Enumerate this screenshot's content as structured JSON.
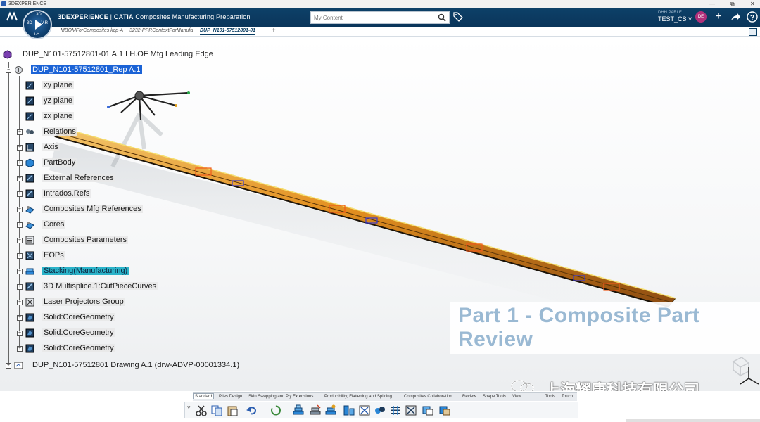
{
  "os": {
    "title": "3DEXPERIENCE",
    "controls": [
      "—",
      "⧉",
      "✕"
    ]
  },
  "header": {
    "app_brand": "3DEXPERIENCE",
    "app_sep": " | ",
    "app_product": "CATIA",
    "app_name": "Composites Manufacturing Preparation",
    "search_placeholder": "My Content",
    "user_small": "DHH PARLE",
    "user_name": "TEST_CS ˅",
    "avatar_initials": "DE",
    "compass": {
      "top": "3D",
      "left": "3D",
      "right": "V.R",
      "bottom": "i.R"
    }
  },
  "tabs": [
    {
      "label": "MBOMForComposites kcp-A",
      "active": false
    },
    {
      "label": "3232-PPRContextForManufa",
      "active": false
    },
    {
      "label": "DUP_N101-57512801-01",
      "active": true
    }
  ],
  "tree": {
    "root_label": "DUP_N101-57512801-01 A.1 LH.OF Mfg Leading Edge",
    "rep_label": "DUP_N101-57512801_Rep A.1",
    "children": [
      {
        "label": "xy plane",
        "icon": "plane-icon"
      },
      {
        "label": "yz plane",
        "icon": "plane-icon"
      },
      {
        "label": "zx plane",
        "icon": "plane-icon"
      },
      {
        "label": "Relations",
        "icon": "relations-icon"
      },
      {
        "label": "Axis",
        "icon": "axis-icon"
      },
      {
        "label": "PartBody",
        "icon": "partbody-icon"
      },
      {
        "label": "External References",
        "icon": "external-ref-icon"
      },
      {
        "label": "Intrados.Refs",
        "icon": "refs-icon"
      },
      {
        "label": "Composites Mfg References",
        "icon": "composites-ref-icon"
      },
      {
        "label": "Cores",
        "icon": "cores-icon"
      },
      {
        "label": "Composites Parameters",
        "icon": "parameters-icon"
      },
      {
        "label": "EOPs",
        "icon": "eop-icon"
      },
      {
        "label": "Stacking(Manufacturing)",
        "icon": "stacking-icon"
      },
      {
        "label": "3D Multisplice.1:CutPieceCurves",
        "icon": "multisplice-icon"
      },
      {
        "label": "Laser Projectors Group",
        "icon": "laser-icon"
      },
      {
        "label": "Solid:CoreGeometry",
        "icon": "solid-icon"
      },
      {
        "label": "Solid:CoreGeometry",
        "icon": "solid-icon"
      },
      {
        "label": "Solid:CoreGeometry",
        "icon": "solid-icon"
      }
    ],
    "drawing_label": "DUP_N101-57512801 Drawing A.1 (drw-ADVP-00001334.1)"
  },
  "overlay": {
    "line1": "Part 1 - Composite Part",
    "line2": "Review"
  },
  "watermark": {
    "text": "上海耀唐科技有限公司"
  },
  "toolbar": {
    "tabs": [
      {
        "label": "Standard",
        "active": true
      },
      {
        "label": "Plies Design",
        "active": false
      },
      {
        "label": "Skin Swapping and Ply Extensions",
        "active": false
      },
      {
        "label": "Producibility, Flattening and Splicing",
        "active": false
      },
      {
        "label": "Composites Collaboration",
        "active": false
      },
      {
        "label": "Review",
        "active": false
      },
      {
        "label": "Shape Tools",
        "active": false
      },
      {
        "label": "View",
        "active": false
      },
      {
        "label": "Tools",
        "active": false
      },
      {
        "label": "Touch",
        "active": false
      }
    ],
    "buttons": [
      "cut-icon",
      "copy-icon",
      "paste-icon",
      "undo-icon",
      "update-icon",
      "stack-a-icon",
      "stack-b-icon",
      "stack-c-icon",
      "stack-d-icon",
      "stack-e-icon",
      "stack-f-icon",
      "stack-g-icon",
      "stack-h-icon",
      "stack-i-icon",
      "stack-j-icon"
    ]
  },
  "colors": {
    "header_bg": "#0a3d62",
    "selection": "#1b63d6",
    "highlight": "#2bb3c9",
    "part_orange": "#e8901a",
    "overlay_text": "#9ab9d3"
  }
}
